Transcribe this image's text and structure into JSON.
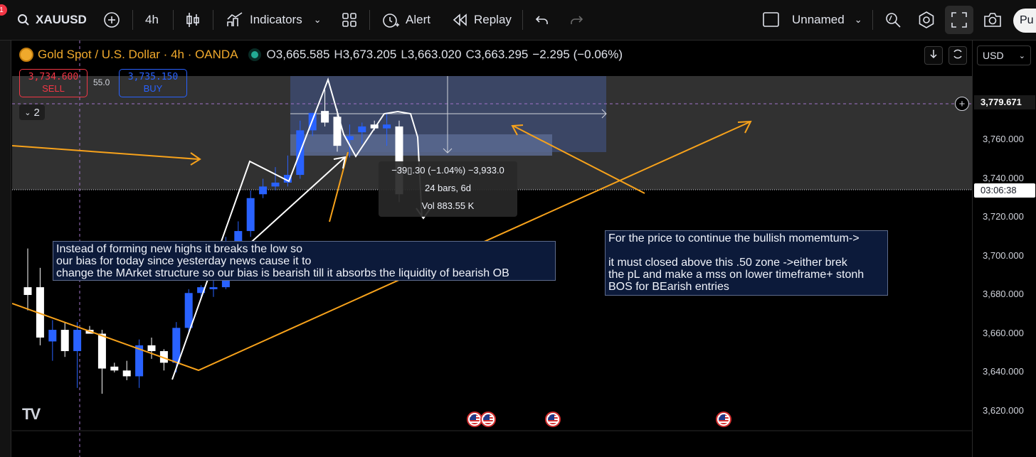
{
  "toolbar": {
    "notification_count": "1",
    "symbol": "XAUUSD",
    "interval": "4h",
    "indicators_label": "Indicators",
    "alert_label": "Alert",
    "replay_label": "Replay",
    "layout_name": "Unnamed",
    "publish_label": "Pu"
  },
  "legend": {
    "title": "Gold Spot / U.S. Dollar · 4h · OANDA",
    "o_key": "O",
    "o_val": "3,665.585",
    "h_key": "H",
    "h_val": "3,673.205",
    "l_key": "L",
    "l_val": "3,663.020",
    "c_key": "C",
    "c_val": "3,663.295",
    "change": "−2.295 (−0.06%)"
  },
  "trade": {
    "sell_price": "3,734.600",
    "sell_label": "SELL",
    "spread": "55.0",
    "buy_price": "3,735.150",
    "buy_label": "BUY",
    "collapse_label": "2"
  },
  "notes": {
    "left": "Instead of forming new highs it breaks the low so\nour bias for today since yesterday news cause it to\nchange the MArket structure so our bias is bearish till it absorbs the liquidity of bearish OB",
    "right": "For the price to continue the bullish momemtum->\n\nit must closed above this .50 zone ->either brek\nthe pL and make a mss on lower timeframe+ stonh\nBOS for BEarish entries"
  },
  "measure": {
    "line1": "−39▯.30 (−1.04%) −3,933.0",
    "line2": "24 bars, 6d",
    "line3": "Vol 883.55 K"
  },
  "axis": {
    "currency": "USD",
    "ticks": [
      "3,760.000",
      "3,740.000",
      "3,720.000",
      "3,700.000",
      "3,680.000",
      "3,660.000",
      "3,640.000",
      "3,620.000"
    ],
    "crosshair_price": "3,779.671",
    "countdown": "03:06:38"
  },
  "colors": {
    "bull": "#2962ff",
    "bear": "#ffffff",
    "accent_orange": "#f7a21b",
    "gold": "#f0a92c",
    "sell": "#f23645",
    "buy": "#2962ff"
  },
  "candles": [
    {
      "o": 3684,
      "h": 3704,
      "l": 3672,
      "c": 3680
    },
    {
      "o": 3684,
      "h": 3694,
      "l": 3654,
      "c": 3658
    },
    {
      "o": 3656,
      "h": 3667,
      "l": 3646,
      "c": 3662
    },
    {
      "o": 3662,
      "h": 3666,
      "l": 3648,
      "c": 3651
    },
    {
      "o": 3651,
      "h": 3666,
      "l": 3632,
      "c": 3662
    },
    {
      "o": 3662,
      "h": 3664,
      "l": 3660,
      "c": 3660
    },
    {
      "o": 3660,
      "h": 3662,
      "l": 3629,
      "c": 3642
    },
    {
      "o": 3643,
      "h": 3645,
      "l": 3640,
      "c": 3641
    },
    {
      "o": 3641,
      "h": 3646,
      "l": 3636,
      "c": 3638
    },
    {
      "o": 3638,
      "h": 3657,
      "l": 3632,
      "c": 3654
    },
    {
      "o": 3654,
      "h": 3658,
      "l": 3647,
      "c": 3651
    },
    {
      "o": 3651,
      "h": 3652,
      "l": 3641,
      "c": 3645
    },
    {
      "o": 3645,
      "h": 3666,
      "l": 3640,
      "c": 3663
    },
    {
      "o": 3663,
      "h": 3683,
      "l": 3660,
      "c": 3681
    },
    {
      "o": 3681,
      "h": 3685,
      "l": 3678,
      "c": 3684
    },
    {
      "o": 3683,
      "h": 3688,
      "l": 3679,
      "c": 3684
    },
    {
      "o": 3684,
      "h": 3710,
      "l": 3683,
      "c": 3706
    },
    {
      "o": 3706,
      "h": 3718,
      "l": 3702,
      "c": 3713
    },
    {
      "o": 3713,
      "h": 3734,
      "l": 3710,
      "c": 3730
    },
    {
      "o": 3732,
      "h": 3740,
      "l": 3730,
      "c": 3736
    },
    {
      "o": 3736,
      "h": 3746,
      "l": 3734,
      "c": 3738
    },
    {
      "o": 3738,
      "h": 3752,
      "l": 3736,
      "c": 3742
    },
    {
      "o": 3742,
      "h": 3770,
      "l": 3740,
      "c": 3765
    },
    {
      "o": 3765,
      "h": 3774,
      "l": 3762,
      "c": 3774
    },
    {
      "o": 3775,
      "h": 3786,
      "l": 3767,
      "c": 3769
    },
    {
      "o": 3772,
      "h": 3776,
      "l": 3754,
      "c": 3757
    },
    {
      "o": 3760,
      "h": 3768,
      "l": 3751,
      "c": 3762
    },
    {
      "o": 3764,
      "h": 3769,
      "l": 3758,
      "c": 3767
    },
    {
      "o": 3768,
      "h": 3770,
      "l": 3765,
      "c": 3766
    },
    {
      "o": 3766,
      "h": 3774,
      "l": 3757,
      "c": 3768
    },
    {
      "o": 3767,
      "h": 3770,
      "l": 3728,
      "c": 3732
    }
  ]
}
